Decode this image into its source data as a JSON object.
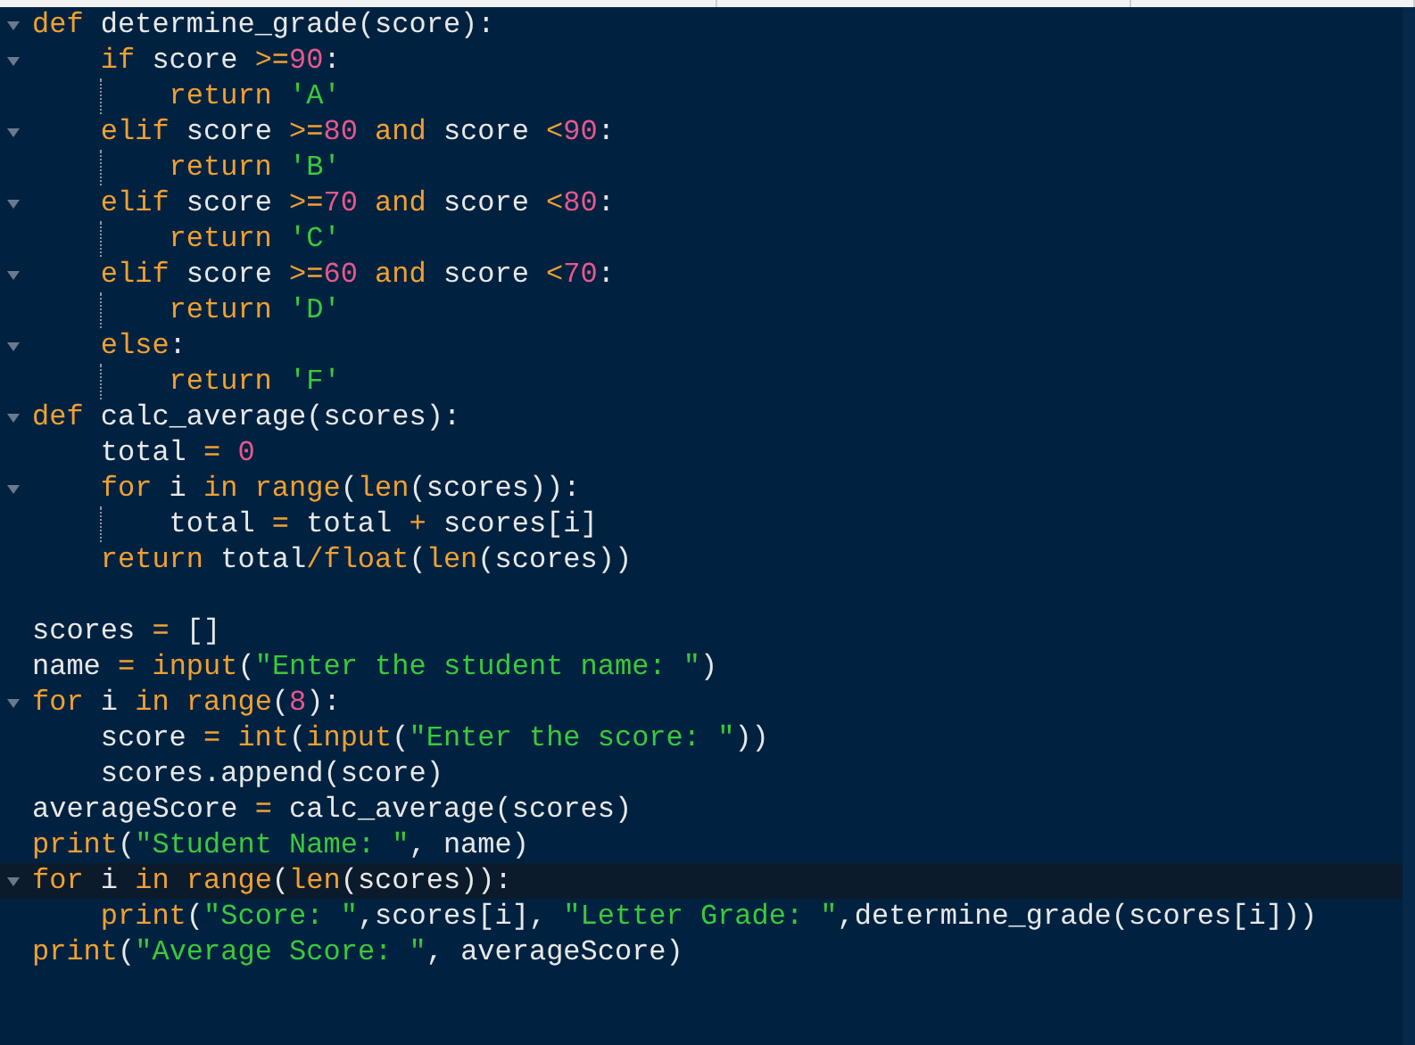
{
  "editor": {
    "lines": [
      {
        "fold": true,
        "highlighted": false,
        "tokens": [
          {
            "kind": "keyword",
            "text": "def "
          },
          {
            "kind": "plain",
            "text": "determine_grade(score):"
          }
        ],
        "children": [
          {
            "fold": true,
            "highlighted": false,
            "tokens": [
              {
                "kind": "keyword",
                "text": "if "
              },
              {
                "kind": "plain",
                "text": "score "
              },
              {
                "kind": "keyword",
                "text": ">="
              },
              {
                "kind": "number",
                "text": "90"
              },
              {
                "kind": "plain",
                "text": ":"
              }
            ],
            "children": [
              {
                "fold": false,
                "highlighted": false,
                "tokens": [
                  {
                    "kind": "keyword",
                    "text": "return "
                  },
                  {
                    "kind": "string",
                    "text": "'A'"
                  }
                ]
              }
            ]
          },
          {
            "fold": true,
            "highlighted": false,
            "tokens": [
              {
                "kind": "keyword",
                "text": "elif "
              },
              {
                "kind": "plain",
                "text": "score "
              },
              {
                "kind": "keyword",
                "text": ">="
              },
              {
                "kind": "number",
                "text": "80 "
              },
              {
                "kind": "keyword",
                "text": "and "
              },
              {
                "kind": "plain",
                "text": "score "
              },
              {
                "kind": "keyword",
                "text": "<"
              },
              {
                "kind": "number",
                "text": "90"
              },
              {
                "kind": "plain",
                "text": ":"
              }
            ],
            "children": [
              {
                "fold": false,
                "highlighted": false,
                "tokens": [
                  {
                    "kind": "keyword",
                    "text": "return "
                  },
                  {
                    "kind": "string",
                    "text": "'B'"
                  }
                ]
              }
            ]
          },
          {
            "fold": true,
            "highlighted": false,
            "tokens": [
              {
                "kind": "keyword",
                "text": "elif "
              },
              {
                "kind": "plain",
                "text": "score "
              },
              {
                "kind": "keyword",
                "text": ">="
              },
              {
                "kind": "number",
                "text": "70 "
              },
              {
                "kind": "keyword",
                "text": "and "
              },
              {
                "kind": "plain",
                "text": "score "
              },
              {
                "kind": "keyword",
                "text": "<"
              },
              {
                "kind": "number",
                "text": "80"
              },
              {
                "kind": "plain",
                "text": ":"
              }
            ],
            "children": [
              {
                "fold": false,
                "highlighted": false,
                "tokens": [
                  {
                    "kind": "keyword",
                    "text": "return "
                  },
                  {
                    "kind": "string",
                    "text": "'C'"
                  }
                ]
              }
            ]
          },
          {
            "fold": true,
            "highlighted": false,
            "tokens": [
              {
                "kind": "keyword",
                "text": "elif "
              },
              {
                "kind": "plain",
                "text": "score "
              },
              {
                "kind": "keyword",
                "text": ">="
              },
              {
                "kind": "number",
                "text": "60 "
              },
              {
                "kind": "keyword",
                "text": "and "
              },
              {
                "kind": "plain",
                "text": "score "
              },
              {
                "kind": "keyword",
                "text": "<"
              },
              {
                "kind": "number",
                "text": "70"
              },
              {
                "kind": "plain",
                "text": ":"
              }
            ],
            "children": [
              {
                "fold": false,
                "highlighted": false,
                "tokens": [
                  {
                    "kind": "keyword",
                    "text": "return "
                  },
                  {
                    "kind": "string",
                    "text": "'D'"
                  }
                ]
              }
            ]
          },
          {
            "fold": true,
            "highlighted": false,
            "tokens": [
              {
                "kind": "keyword",
                "text": "else"
              },
              {
                "kind": "plain",
                "text": ":"
              }
            ],
            "children": [
              {
                "fold": false,
                "highlighted": false,
                "tokens": [
                  {
                    "kind": "keyword",
                    "text": "return "
                  },
                  {
                    "kind": "string",
                    "text": "'F'"
                  }
                ]
              }
            ]
          }
        ]
      },
      {
        "fold": true,
        "highlighted": false,
        "tokens": [
          {
            "kind": "keyword",
            "text": "def "
          },
          {
            "kind": "plain",
            "text": "calc_average(scores):"
          }
        ],
        "children": [
          {
            "fold": false,
            "highlighted": false,
            "tokens": [
              {
                "kind": "plain",
                "text": "total "
              },
              {
                "kind": "keyword",
                "text": "= "
              },
              {
                "kind": "number",
                "text": "0"
              }
            ]
          },
          {
            "fold": true,
            "highlighted": false,
            "tokens": [
              {
                "kind": "keyword",
                "text": "for "
              },
              {
                "kind": "plain",
                "text": "i "
              },
              {
                "kind": "keyword",
                "text": "in range"
              },
              {
                "kind": "plain",
                "text": "("
              },
              {
                "kind": "keyword",
                "text": "len"
              },
              {
                "kind": "plain",
                "text": "(scores)):"
              }
            ],
            "children": [
              {
                "fold": false,
                "highlighted": false,
                "tokens": [
                  {
                    "kind": "plain",
                    "text": "total "
                  },
                  {
                    "kind": "keyword",
                    "text": "="
                  },
                  {
                    "kind": "plain",
                    "text": " total "
                  },
                  {
                    "kind": "keyword",
                    "text": "+"
                  },
                  {
                    "kind": "plain",
                    "text": " scores[i]"
                  }
                ]
              }
            ]
          },
          {
            "fold": false,
            "highlighted": false,
            "tokens": [
              {
                "kind": "keyword",
                "text": "return "
              },
              {
                "kind": "plain",
                "text": "total"
              },
              {
                "kind": "keyword",
                "text": "/float"
              },
              {
                "kind": "plain",
                "text": "("
              },
              {
                "kind": "keyword",
                "text": "len"
              },
              {
                "kind": "plain",
                "text": "(scores))"
              }
            ]
          }
        ]
      },
      {
        "fold": false,
        "highlighted": false
      },
      {
        "fold": false,
        "highlighted": false,
        "tokens": [
          {
            "kind": "plain",
            "text": "scores "
          },
          {
            "kind": "keyword",
            "text": "="
          },
          {
            "kind": "plain",
            "text": " []"
          }
        ]
      },
      {
        "fold": false,
        "highlighted": false,
        "tokens": [
          {
            "kind": "plain",
            "text": "name "
          },
          {
            "kind": "keyword",
            "text": "= input"
          },
          {
            "kind": "plain",
            "text": "("
          },
          {
            "kind": "string",
            "text": "\"Enter the student name: \""
          },
          {
            "kind": "plain",
            "text": ")"
          }
        ]
      },
      {
        "fold": true,
        "highlighted": false,
        "tokens": [
          {
            "kind": "keyword",
            "text": "for "
          },
          {
            "kind": "plain",
            "text": "i "
          },
          {
            "kind": "keyword",
            "text": "in range"
          },
          {
            "kind": "plain",
            "text": "("
          },
          {
            "kind": "number",
            "text": "8"
          },
          {
            "kind": "plain",
            "text": "):"
          }
        ],
        "children": [
          {
            "fold": false,
            "highlighted": false,
            "tokens": [
              {
                "kind": "plain",
                "text": "score "
              },
              {
                "kind": "keyword",
                "text": "= int"
              },
              {
                "kind": "plain",
                "text": "("
              },
              {
                "kind": "keyword",
                "text": "input"
              },
              {
                "kind": "plain",
                "text": "("
              },
              {
                "kind": "string",
                "text": "\"Enter the score: \""
              },
              {
                "kind": "plain",
                "text": "))"
              }
            ]
          },
          {
            "fold": false,
            "highlighted": false,
            "tokens": [
              {
                "kind": "plain",
                "text": "scores.append(score)"
              }
            ]
          }
        ]
      },
      {
        "fold": false,
        "highlighted": false,
        "tokens": [
          {
            "kind": "plain",
            "text": "averageScore "
          },
          {
            "kind": "keyword",
            "text": "="
          },
          {
            "kind": "plain",
            "text": " calc_average(scores)"
          }
        ]
      },
      {
        "fold": false,
        "highlighted": false,
        "tokens": [
          {
            "kind": "keyword",
            "text": "print"
          },
          {
            "kind": "plain",
            "text": "("
          },
          {
            "kind": "string",
            "text": "\"Student Name: \""
          },
          {
            "kind": "plain",
            "text": ", name)"
          }
        ]
      },
      {
        "fold": true,
        "highlighted": true,
        "tokens": [
          {
            "kind": "keyword",
            "text": "for "
          },
          {
            "kind": "plain",
            "text": "i "
          },
          {
            "kind": "keyword",
            "text": "in range"
          },
          {
            "kind": "plain",
            "text": "("
          },
          {
            "kind": "keyword",
            "text": "len"
          },
          {
            "kind": "plain",
            "text": "(scores)):"
          }
        ],
        "children": [
          {
            "fold": false,
            "highlighted": false,
            "tokens": [
              {
                "kind": "keyword",
                "text": "print"
              },
              {
                "kind": "plain",
                "text": "("
              },
              {
                "kind": "string",
                "text": "\"Score: \""
              },
              {
                "kind": "plain",
                "text": ",scores[i], "
              },
              {
                "kind": "string",
                "text": "\"Letter Grade: \""
              },
              {
                "kind": "plain",
                "text": ",determine_grade(scores[i]))"
              }
            ]
          }
        ]
      },
      {
        "fold": false,
        "highlighted": false,
        "tokens": [
          {
            "kind": "keyword",
            "text": "print"
          },
          {
            "kind": "plain",
            "text": "("
          },
          {
            "kind": "string",
            "text": "\"Average Score: \""
          },
          {
            "kind": "plain",
            "text": ", averageScore)"
          }
        ]
      }
    ]
  }
}
